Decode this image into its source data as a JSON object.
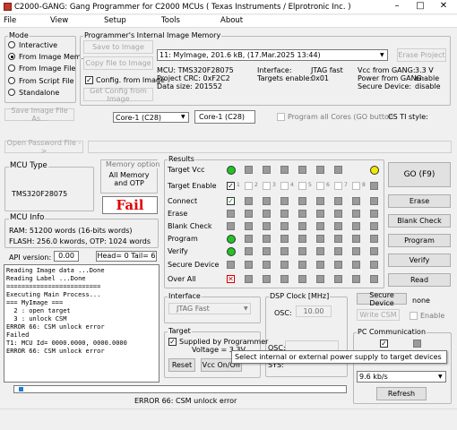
{
  "window": {
    "title": "C2000-GANG:  Gang Programmer for C2000  MCUs ( Texas Instruments / Elprotronic Inc. )",
    "minimize": "–",
    "maximize": "□",
    "close": "✕"
  },
  "menu": [
    "File",
    "View",
    "Setup",
    "Tools",
    "About"
  ],
  "mode": {
    "title": "Mode",
    "options": [
      "Interactive",
      "From Image Mem.",
      "From Image File",
      "From Script File",
      "Standalone"
    ],
    "selected": 1
  },
  "image_memory": {
    "title": "Programmer's Internal Image Memory",
    "save_btn": "Save to Image",
    "copy_btn": "Copy file to Image",
    "config_chk": "Config. from Image",
    "get_config_btn": "Get Config from Image",
    "selected_image": "11: MyImage, 201.6 kB,  (17.Mar.2025  13:44)",
    "erase_btn": "Erase Project",
    "info": [
      [
        "MCU:   TMS320F28075",
        "Interface:",
        "JTAG fast",
        "Vcc from GANG:",
        "3.3 V"
      ],
      [
        "Project CRC:  0xF2C2",
        "Targets enable:",
        "0x01",
        "Power from GANG:",
        "enable"
      ],
      [
        "Data size:      201552",
        "",
        "",
        "Secure Device:",
        "disable"
      ]
    ]
  },
  "save_image_btn": "Save Image File As...",
  "core_select": "Core-1 (C28)",
  "core_field": "Core-1 (C28)",
  "program_all_cores": "Program all Cores (GO button",
  "cs_ti": "CS TI style:",
  "open_password_btn": "Open Password File ->",
  "mcu_type": {
    "title": "MCU Type",
    "value": "TMS320F28075"
  },
  "memory_option": {
    "title": "Memory option",
    "value": "All Memory\nand OTP"
  },
  "fail_text": "Fail",
  "mcu_info": {
    "title": "MCU Info",
    "ram": "RAM: 51200 words (16-bits words)",
    "flash": "FLASH: 256.0 kwords,  OTP: 1024 words"
  },
  "api_version_label": "API version:",
  "api_version": "0.00",
  "head_tail": "Head= 0  Tail= 6",
  "log": [
    "Reading Image data ...Done",
    "Reading Label ...Done",
    "=========================",
    "Executing Main Process...",
    "=== MyImage ===",
    "",
    "  2 : open target",
    "  3 : unlock CSM",
    "",
    "ERROR 66: CSM unlock error",
    "Failed",
    "T1: MCU Id= 0000.0000, 0000.0000",
    "ERROR 66: CSM unlock error"
  ],
  "results": {
    "title": "Results",
    "rows": [
      "Target Vcc",
      "Target Enable",
      "Connect",
      "Erase",
      "Blank Check",
      "Program",
      "Verify",
      "Secure Device",
      "Over All"
    ],
    "target_nums": [
      "1",
      "2",
      "3",
      "4",
      "5",
      "6",
      "7",
      "8"
    ]
  },
  "buttons": {
    "go": "GO   (F9)",
    "erase": "Erase",
    "blank_check": "Blank Check",
    "program": "Program",
    "verify": "Verify",
    "read": "Read"
  },
  "interface": {
    "title": "Interface",
    "value": "JTAG Fast"
  },
  "dsp_clock": {
    "title": "DSP Clock [MHz]",
    "osc_label": "OSC:",
    "osc_value": "10.00",
    "osc2_label": "OSC:",
    "sys_label": "SYS:"
  },
  "secure_device_btn": "Secure Device",
  "secure_value": "none",
  "write_csm_btn": "Write CSM",
  "enable_chk": "Enable",
  "target": {
    "title": "Target",
    "supplied": "Supplied by Programmer",
    "voltage": "Voltage = 3.3V",
    "reset_btn": "Reset",
    "vcc_btn": "Vcc On/Off"
  },
  "pc_comm": {
    "title": "PC Communication",
    "baud": "9.6 kb/s",
    "refresh_btn": "Refresh"
  },
  "tooltip": "Select internal or external power supply to target devices",
  "status_text": "ERROR 66: CSM unlock error",
  "colors": {
    "green": "#22c522",
    "yellow": "#f0e800",
    "fail_red": "#e00000",
    "progress": "#1e7fd8"
  }
}
